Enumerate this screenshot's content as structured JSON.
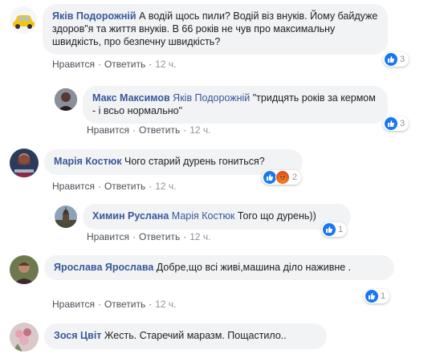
{
  "actions": {
    "like": "Нравится",
    "reply": "Ответить",
    "separator": "·"
  },
  "colors": {
    "link": "#385898",
    "bubble": "#f2f3f5",
    "like": "#1877f2"
  },
  "comments": [
    {
      "author": "Яків Подорожній",
      "text": "А водій щось пили? Водій віз внуків. Йому байдуже здоров\"я та життя внуків. В 66 років не чув про максимальну швидкість, про безпечну швидкість?",
      "time": "12 ч.",
      "reaction_count": "3",
      "reactions": [
        "like-icon"
      ]
    },
    {
      "author": "Макс Максимов",
      "mention": "Яків Подорожній",
      "text": "\"тридцять років за кермом - і всьо нормально\"",
      "time": "12 ч.",
      "reaction_count": "3",
      "reactions": [
        "like-icon"
      ]
    },
    {
      "author": "Марія Костюк",
      "text": "Чого старий дурень гониться?",
      "time": "12 ч.",
      "reaction_count": "2",
      "reactions": [
        "like-icon",
        "angry-icon"
      ]
    },
    {
      "author": "Химин Руслана",
      "mention": "Марія Костюк",
      "text": "Того що дурень))",
      "time": "12 ч.",
      "reaction_count": "1",
      "reactions": [
        "like-icon"
      ]
    },
    {
      "author": "Ярослава Ярослава",
      "text": "Добре,що всі живі,машина діло наживне .",
      "time": "12 ч.",
      "reaction_count": "1",
      "reactions": [
        "like-icon"
      ]
    },
    {
      "author": "Зося Цвіт",
      "text": "Жесть. Старечий маразм. Пощастило..",
      "time": "",
      "reaction_count": "",
      "reactions": []
    }
  ]
}
